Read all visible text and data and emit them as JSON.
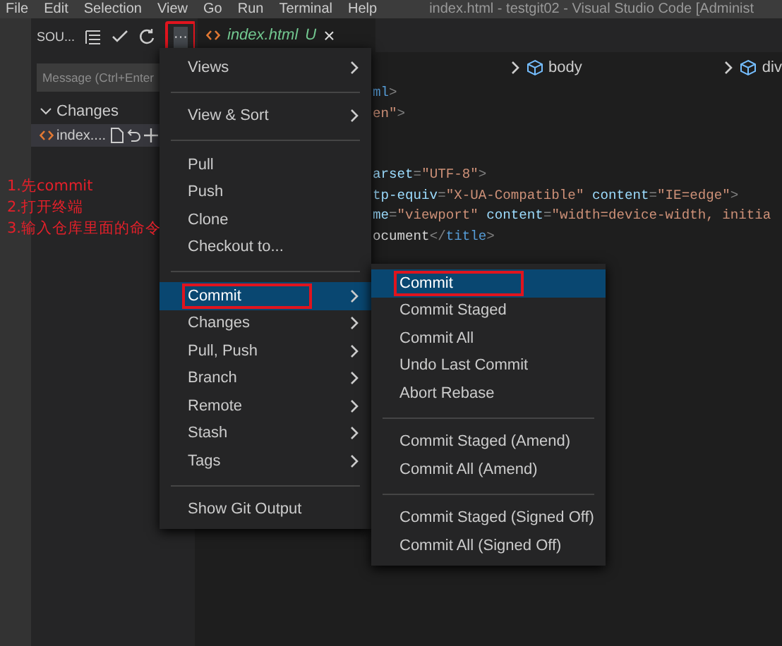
{
  "menu_bar": [
    "File",
    "Edit",
    "Selection",
    "View",
    "Go",
    "Run",
    "Terminal",
    "Help"
  ],
  "window": {
    "title": "index.html - testgit02 - Visual Studio Code [Administ"
  },
  "sidebar": {
    "title": "SOU...",
    "more_button": {
      "label": "···",
      "boxed": true
    },
    "message": {
      "placeholder": "Message (Ctrl+Enter"
    },
    "changes": {
      "label": "Changes",
      "expanded": true,
      "files": [
        {
          "name": "index....",
          "selected": true
        }
      ]
    }
  },
  "tab": {
    "name": "index.html",
    "status": "U",
    "close": "×"
  },
  "breadcrumb": [
    "body",
    "div"
  ],
  "code": [
    {
      "gap": false,
      "tokens": [
        {
          "kind": "tag",
          "text": "ml"
        },
        {
          "kind": "punct",
          "text": ">"
        }
      ]
    },
    {
      "gap": false,
      "tokens": [
        {
          "kind": "string",
          "text": "en\""
        },
        {
          "kind": "punct",
          "text": ">"
        }
      ]
    },
    {
      "gap": true,
      "tokens": [
        {
          "kind": "attr",
          "text": "arset"
        },
        {
          "kind": "punct",
          "text": "="
        },
        {
          "kind": "string",
          "text": "\"UTF-8\""
        },
        {
          "kind": "punct",
          "text": ">"
        }
      ]
    },
    {
      "gap": false,
      "tokens": [
        {
          "kind": "attr",
          "text": "tp-equiv"
        },
        {
          "kind": "punct",
          "text": "="
        },
        {
          "kind": "string",
          "text": "\"X-UA-Compatible\" "
        },
        {
          "kind": "attr",
          "text": "content"
        },
        {
          "kind": "punct",
          "text": "="
        },
        {
          "kind": "string",
          "text": "\"IE=edge\""
        },
        {
          "kind": "punct",
          "text": ">"
        }
      ]
    },
    {
      "gap": false,
      "tokens": [
        {
          "kind": "attr",
          "text": "me"
        },
        {
          "kind": "punct",
          "text": "="
        },
        {
          "kind": "string",
          "text": "\"viewport\" "
        },
        {
          "kind": "attr",
          "text": "content"
        },
        {
          "kind": "punct",
          "text": "="
        },
        {
          "kind": "string",
          "text": "\"width=device-width, initia"
        }
      ]
    },
    {
      "gap": false,
      "tokens": [
        {
          "kind": "text",
          "text": "ocument"
        },
        {
          "kind": "punct",
          "text": "</"
        },
        {
          "kind": "tag",
          "text": "title"
        },
        {
          "kind": "punct",
          "text": ">"
        }
      ]
    }
  ],
  "annotation": [
    "1.先commit",
    "2.打开终端",
    "3.输入仓库里面的命令"
  ],
  "menu": [
    {
      "kind": "item",
      "label": "Views",
      "submenu": true,
      "selected": false,
      "boxed": false
    },
    {
      "kind": "separator"
    },
    {
      "kind": "item",
      "label": "View & Sort",
      "submenu": true,
      "selected": false,
      "boxed": false
    },
    {
      "kind": "separator"
    },
    {
      "kind": "item",
      "label": "Pull",
      "submenu": false,
      "selected": false,
      "boxed": false
    },
    {
      "kind": "item",
      "label": "Push",
      "submenu": false,
      "selected": false,
      "boxed": false
    },
    {
      "kind": "item",
      "label": "Clone",
      "submenu": false,
      "selected": false,
      "boxed": false
    },
    {
      "kind": "item",
      "label": "Checkout to...",
      "submenu": false,
      "selected": false,
      "boxed": false
    },
    {
      "kind": "separator"
    },
    {
      "kind": "item",
      "label": "Commit",
      "submenu": true,
      "selected": true,
      "boxed": true
    },
    {
      "kind": "item",
      "label": "Changes",
      "submenu": true,
      "selected": false,
      "boxed": false
    },
    {
      "kind": "item",
      "label": "Pull, Push",
      "submenu": true,
      "selected": false,
      "boxed": false
    },
    {
      "kind": "item",
      "label": "Branch",
      "submenu": true,
      "selected": false,
      "boxed": false
    },
    {
      "kind": "item",
      "label": "Remote",
      "submenu": true,
      "selected": false,
      "boxed": false
    },
    {
      "kind": "item",
      "label": "Stash",
      "submenu": true,
      "selected": false,
      "boxed": false
    },
    {
      "kind": "item",
      "label": "Tags",
      "submenu": true,
      "selected": false,
      "boxed": false
    },
    {
      "kind": "separator"
    },
    {
      "kind": "item",
      "label": "Show Git Output",
      "submenu": false,
      "selected": false,
      "boxed": false
    }
  ],
  "submenu": [
    {
      "kind": "item",
      "label": "Commit",
      "selected": true,
      "boxed": true
    },
    {
      "kind": "item",
      "label": "Commit Staged",
      "selected": false,
      "boxed": false
    },
    {
      "kind": "item",
      "label": "Commit All",
      "selected": false,
      "boxed": false
    },
    {
      "kind": "item",
      "label": "Undo Last Commit",
      "selected": false,
      "boxed": false
    },
    {
      "kind": "item",
      "label": "Abort Rebase",
      "selected": false,
      "boxed": false
    },
    {
      "kind": "separator"
    },
    {
      "kind": "item",
      "label": "Commit Staged (Amend)",
      "selected": false,
      "boxed": false
    },
    {
      "kind": "item",
      "label": "Commit All (Amend)",
      "selected": false,
      "boxed": false
    },
    {
      "kind": "separator"
    },
    {
      "kind": "item",
      "label": "Commit Staged (Signed Off)",
      "selected": false,
      "boxed": false
    },
    {
      "kind": "item",
      "label": "Commit All (Signed Off)",
      "selected": false,
      "boxed": false
    }
  ]
}
